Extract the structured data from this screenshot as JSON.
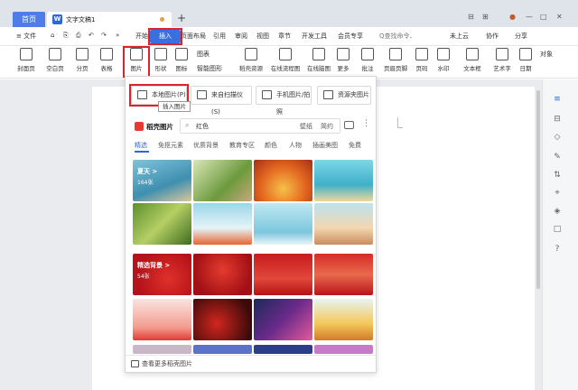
{
  "tabs": {
    "home": "首页",
    "doc": "文字文稿1",
    "new": "+"
  },
  "window": {
    "controls": [
      "⊟",
      "⊞",
      "●",
      "—",
      "□",
      "✕"
    ]
  },
  "menu": {
    "left_items": [
      "≡ 文件",
      "⌂",
      "⎘",
      "⎙",
      "↶",
      "↷",
      "»"
    ],
    "start": "开始",
    "insert": "插入",
    "tabs": [
      "页面布局",
      "引用",
      "审阅",
      "视图",
      "章节",
      "开发工具",
      "会员专享"
    ],
    "search": "Q查找命令、",
    "right": [
      "未上云",
      "协作",
      "分享"
    ]
  },
  "ribbon": {
    "items": [
      "封面页",
      "空白页",
      "分页",
      "表格",
      "图片",
      "形状",
      "图标",
      "智能图形",
      "稻壳资源",
      "在线流程图",
      "在线脑图",
      "更多",
      "批注",
      "页眉页脚",
      "页码",
      "水印",
      "文本框",
      "艺术字",
      "日期",
      "对象"
    ],
    "chart": "图表"
  },
  "dropdown": {
    "buttons": [
      "本地图片(P)",
      "来自扫描仪(S)",
      "手机图片/拍照",
      "资源夹图片"
    ],
    "tooltip": "插入图片",
    "brand": "稻壳图片",
    "search_placeholder": "红色",
    "search_links": [
      "壁纸",
      "简约"
    ],
    "categories": [
      "精选",
      "免抠元素",
      "优质背景",
      "教育专区",
      "颜色",
      "人物",
      "插画美图",
      "免费"
    ],
    "thumb_labels": {
      "summer": "夏天 >",
      "summer_count": "164张",
      "festive": "精选背景 >",
      "festive_count": "54张"
    },
    "footer": "查看更多稻壳图片"
  },
  "sidebar_icons": [
    "≡",
    "⊟",
    "◇",
    "✎",
    "⇅",
    "⌖",
    "◈",
    "□",
    "?"
  ]
}
